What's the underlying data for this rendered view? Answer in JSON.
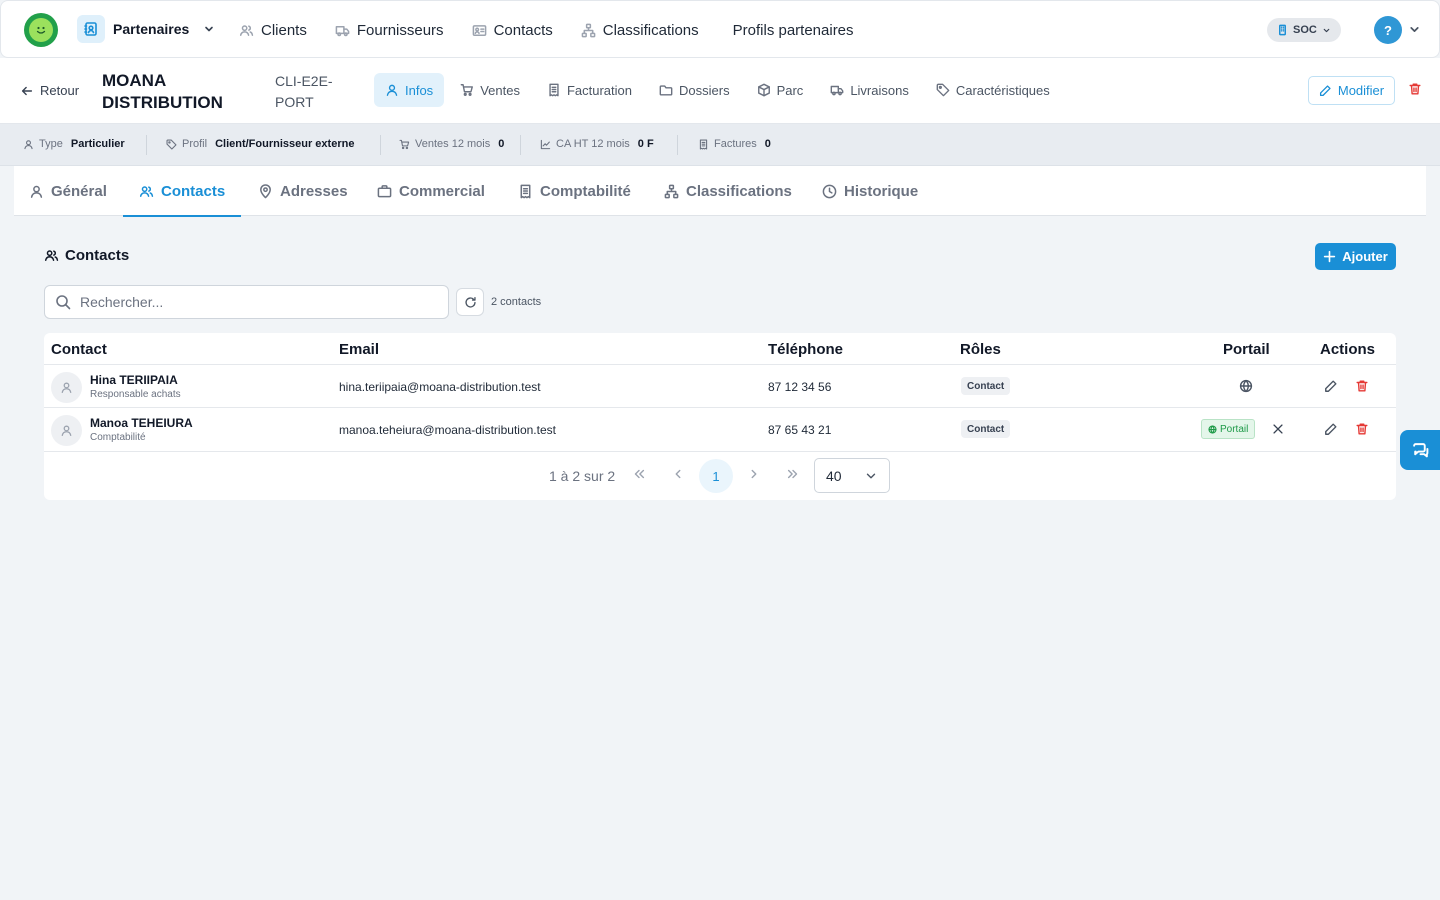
{
  "topbar": {
    "module_label": "Partenaires",
    "nav": [
      {
        "label": "Clients",
        "icon": "users-icon"
      },
      {
        "label": "Fournisseurs",
        "icon": "truck-icon"
      },
      {
        "label": "Contacts",
        "icon": "id-card-icon"
      },
      {
        "label": "Classifications",
        "icon": "hierarchy-icon"
      },
      {
        "label": "Profils partenaires",
        "icon": ""
      }
    ],
    "company_label": "SOC",
    "user_initial": "?"
  },
  "record": {
    "back_label": "Retour",
    "name": "MOANA DISTRIBUTION",
    "code": "CLI-E2E-PORT",
    "tabs": [
      {
        "label": "Infos",
        "icon": "user-icon",
        "active": true
      },
      {
        "label": "Ventes",
        "icon": "cart-icon"
      },
      {
        "label": "Facturation",
        "icon": "receipt-icon"
      },
      {
        "label": "Dossiers",
        "icon": "folder-icon"
      },
      {
        "label": "Parc",
        "icon": "box-icon"
      },
      {
        "label": "Livraisons",
        "icon": "truck-icon"
      },
      {
        "label": "Caractéristiques",
        "icon": "tag-icon"
      }
    ],
    "edit_label": "Modifier"
  },
  "kpis": {
    "type_label": "Type",
    "type_value": "Particulier",
    "profile_label": "Profil",
    "profile_value": "Client/Fournisseur externe",
    "sales_label": "Ventes 12 mois",
    "sales_value": "0",
    "revenue_label": "CA HT 12 mois",
    "revenue_value": "0 F",
    "invoices_label": "Factures",
    "invoices_value": "0"
  },
  "section_tabs": [
    {
      "label": "Général",
      "icon": "user-icon"
    },
    {
      "label": "Contacts",
      "icon": "users-icon",
      "active": true
    },
    {
      "label": "Adresses",
      "icon": "map-pin-icon"
    },
    {
      "label": "Commercial",
      "icon": "briefcase-icon"
    },
    {
      "label": "Comptabilité",
      "icon": "receipt-icon"
    },
    {
      "label": "Classifications",
      "icon": "hierarchy-icon"
    },
    {
      "label": "Historique",
      "icon": "clock-icon"
    }
  ],
  "contacts": {
    "title": "Contacts",
    "add_label": "Ajouter",
    "search_placeholder": "Rechercher...",
    "count_text": "2 contacts",
    "columns": [
      "Contact",
      "Email",
      "Téléphone",
      "Rôles",
      "Portail",
      "Actions"
    ],
    "rows": [
      {
        "name": "Hina TERIIPAIA",
        "function": "Responsable achats",
        "email": "hina.teriipaia@moana-distribution.test",
        "phone": "87 12 34 56",
        "role": "Contact",
        "portal": false
      },
      {
        "name": "Manoa TEHEIURA",
        "function": "Comptabilité",
        "email": "manoa.teheiura@moana-distribution.test",
        "phone": "87 65 43 21",
        "role": "Contact",
        "portal": true,
        "portal_label": "Portail"
      }
    ],
    "pagination": {
      "summary": "1 à 2 sur 2",
      "current_page": "1",
      "page_size": "40"
    }
  },
  "colors": {
    "accent": "#1a8fd6",
    "danger": "#e53935",
    "success": "#1e9a48"
  }
}
